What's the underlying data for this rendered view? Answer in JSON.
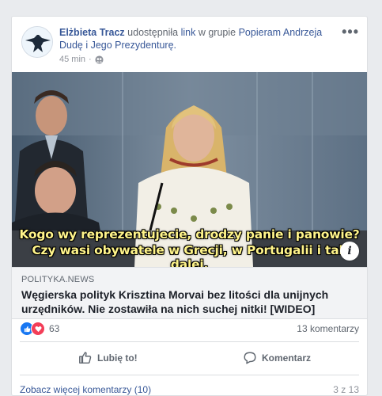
{
  "post": {
    "author": "Elżbieta Tracz",
    "shared_text": "udostępniła",
    "link_word": "link",
    "in_group_text": "w grupie",
    "group_name": "Popieram Andrzeja Dudę i Jego Prezydenturę.",
    "time": "45 min",
    "privacy_icon": "group-icon",
    "options_icon": "more-dots-icon"
  },
  "video": {
    "subtitle_line1": "Kogo wy reprezentujecie, drodzy panie i panowie?",
    "subtitle_line2": "Czy wasi obywatele w Grecji, w Portugalii i tak dalej.",
    "info_icon": "i"
  },
  "link_preview": {
    "domain": "POLITYKA.NEWS",
    "headline": "Węgierska polityk Krisztina Morvai bez litości dla unijnych urzędników. Nie zostawiła na nich suchej nitki! [WIDEO]"
  },
  "engagement": {
    "reaction_count": "63",
    "reaction_icons": [
      "like-icon",
      "love-icon"
    ],
    "comments_count": "13 komentarzy"
  },
  "actions": {
    "like_label": "Lubię to!",
    "comment_label": "Komentarz"
  },
  "comments": {
    "view_more": "Zobacz więcej komentarzy (10)",
    "page_indicator": "3 z 13"
  },
  "colors": {
    "link_blue": "#385898",
    "like_blue": "#1877f2",
    "love_red": "#f33e58",
    "subtitle_yellow": "#fff48a"
  }
}
